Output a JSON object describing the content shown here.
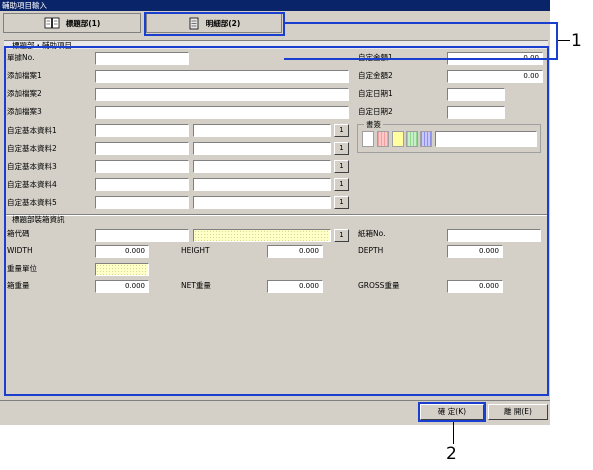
{
  "window": {
    "title": "輔助項目輸入"
  },
  "tabs": [
    {
      "label": "標題部(1)",
      "icon": "book-icon"
    },
    {
      "label": "明細部(2)",
      "icon": "document-icon"
    }
  ],
  "header_section": {
    "title": "標題部・輔助項目"
  },
  "fields": {
    "order_no": {
      "label": "單據No.",
      "value": ""
    },
    "remark1": {
      "label": "添加檔案1",
      "value": ""
    },
    "remark2": {
      "label": "添加檔案2",
      "value": ""
    },
    "remark3": {
      "label": "添加檔案3",
      "value": ""
    },
    "custom_amount1": {
      "label": "自定金額1",
      "value": "0.00"
    },
    "custom_amount2": {
      "label": "自定金額2",
      "value": "0.00"
    },
    "custom_date1": {
      "label": "自定日期1",
      "value": ""
    },
    "custom_date2": {
      "label": "自定日期2",
      "value": ""
    },
    "custom_master": [
      {
        "label": "自定基本資料1",
        "lookup": "1"
      },
      {
        "label": "自定基本資料2",
        "lookup": "1"
      },
      {
        "label": "自定基本資料3",
        "lookup": "1"
      },
      {
        "label": "自定基本資料4",
        "lookup": "1"
      },
      {
        "label": "自定基本資料5",
        "lookup": "1"
      }
    ]
  },
  "notes_group": {
    "label": "書簽",
    "colors": [
      "#ffffff",
      "#ffc8c8",
      "#ffffa0",
      "#c8f0c8",
      "#c8c8ff"
    ]
  },
  "packing_section": {
    "title": "標題部裝箱資訊",
    "box_code": {
      "label": "箱代碼",
      "lookup": "1"
    },
    "paper_box_no": {
      "label": "紙箱No."
    },
    "width": {
      "label": "WIDTH",
      "value": "0.000"
    },
    "height": {
      "label": "HEIGHT",
      "value": "0.000"
    },
    "depth": {
      "label": "DEPTH",
      "value": "0.000"
    },
    "weight_unit": {
      "label": "重量單位"
    },
    "box_weight": {
      "label": "箱重量",
      "value": "0.000"
    },
    "net_weight": {
      "label": "NET重量",
      "value": "0.000"
    },
    "gross_weight": {
      "label": "GROSS重量",
      "value": "0.000"
    }
  },
  "buttons": {
    "ok": "確 定(K)",
    "close": "離 開(E)"
  },
  "callouts": {
    "one": "1",
    "two": "2"
  },
  "colors": {
    "titlebar": "#0a246a",
    "callout": "#1a3fd0",
    "window": "#d4d0c8"
  }
}
